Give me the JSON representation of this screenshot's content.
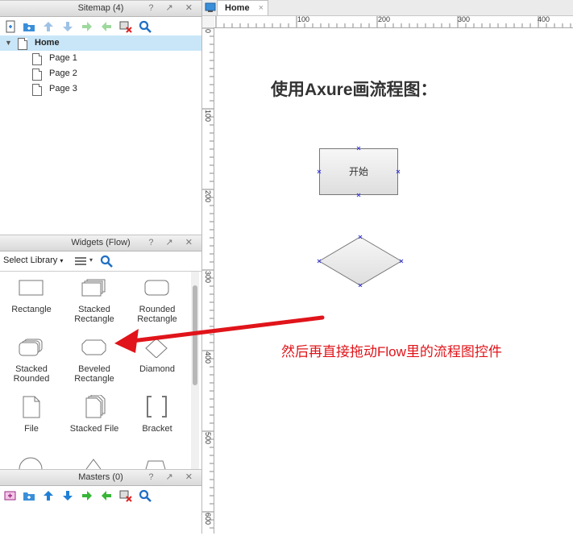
{
  "sitemap": {
    "title": "Sitemap (4)",
    "controls": "? ↗ ✕",
    "pages": [
      {
        "label": "Home"
      },
      {
        "label": "Page 1"
      },
      {
        "label": "Page 2"
      },
      {
        "label": "Page 3"
      }
    ]
  },
  "widgets": {
    "title": "Widgets (Flow)",
    "controls": "? ↗ ✕",
    "select_library_label": "Select Library",
    "items": [
      {
        "line1": "Rectangle",
        "line2": ""
      },
      {
        "line1": "Stacked",
        "line2": "Rectangle"
      },
      {
        "line1": "Rounded",
        "line2": "Rectangle"
      },
      {
        "line1": "Stacked",
        "line2": "Rounded"
      },
      {
        "line1": "Beveled",
        "line2": "Rectangle"
      },
      {
        "line1": "Diamond",
        "line2": ""
      },
      {
        "line1": "File",
        "line2": ""
      },
      {
        "line1": "Stacked File",
        "line2": ""
      },
      {
        "line1": "Bracket",
        "line2": ""
      }
    ]
  },
  "masters": {
    "title": "Masters (0)",
    "controls": "? ↗ ✕"
  },
  "editor": {
    "tab_label": "Home",
    "tab_close": "×",
    "hruler_ticks": [
      "100",
      "200",
      "300",
      "400"
    ],
    "vruler_ticks": [
      "0",
      "100",
      "200",
      "300",
      "400",
      "500",
      "600"
    ],
    "canvas_title": "使用Axure画流程图：",
    "start_box_label": "开始",
    "annotation": "然后再直接拖动Flow里的流程图控件"
  },
  "colors": {
    "selection": "#c9e6f8",
    "annotation_red": "#e0141a",
    "handle_blue": "#3a3ad0",
    "panel_header": "#dcdcdc"
  }
}
